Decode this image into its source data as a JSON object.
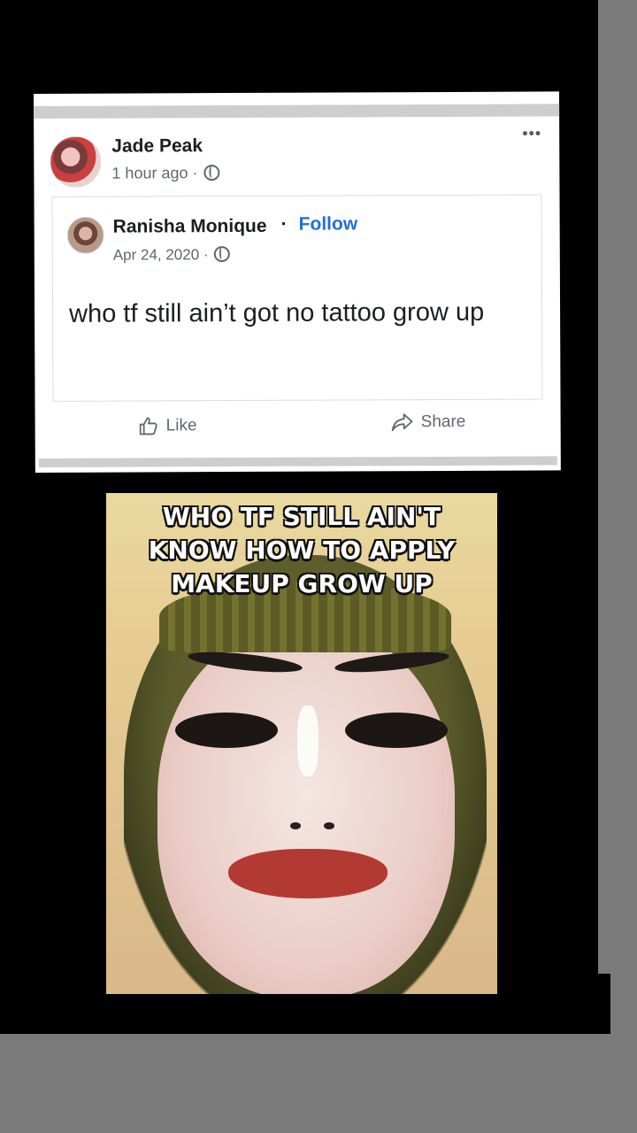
{
  "post": {
    "author": "Jade Peak",
    "time": "1 hour ago · ",
    "more_label": "•••",
    "shared": {
      "author": "Ranisha Monique",
      "separator": "·",
      "follow": "Follow",
      "date": "Apr 24, 2020 · ",
      "text": "who tf still ain’t got no tattoo grow up"
    },
    "actions": {
      "like": "Like",
      "share": "Share"
    }
  },
  "meme": {
    "caption_lines": [
      "Who TF still ain't",
      "Know how to apply",
      "makeup grow up"
    ]
  },
  "colors": {
    "follow": "#216fdb",
    "background": "#7a7a7a"
  },
  "icons": [
    "avatar",
    "globe-icon",
    "like-icon",
    "share-icon",
    "more-icon"
  ]
}
